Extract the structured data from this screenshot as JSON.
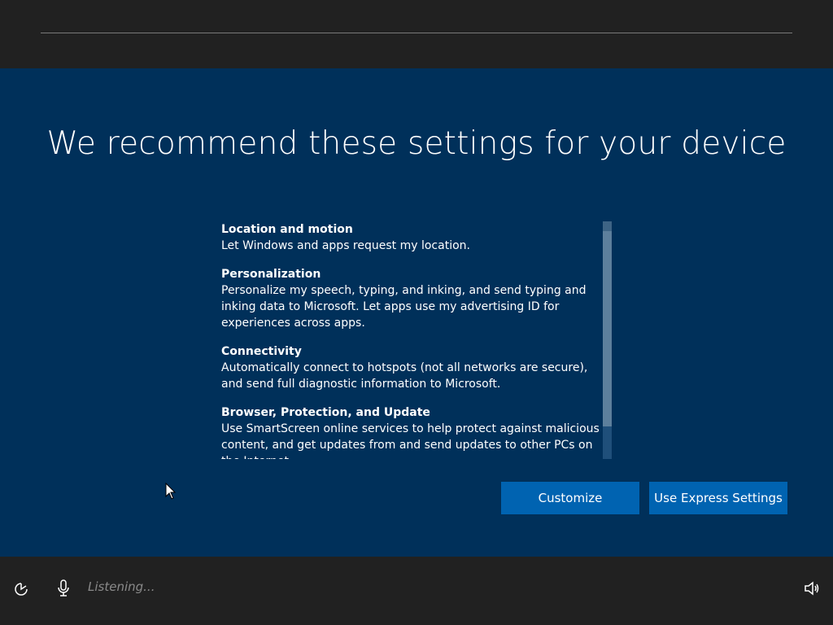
{
  "header": {},
  "main": {
    "title": "We recommend these settings for your device",
    "sections": [
      {
        "title": "Location and motion",
        "text": "Let Windows and apps request my location."
      },
      {
        "title": "Personalization",
        "text": "Personalize my speech, typing, and inking, and send typing and inking data to Microsoft. Let apps use my advertising ID for experiences across apps."
      },
      {
        "title": "Connectivity",
        "text": "Automatically connect to hotspots (not all networks are secure), and send full diagnostic information to Microsoft."
      },
      {
        "title": "Browser, Protection, and Update",
        "text": "Use SmartScreen online services to help protect against malicious content, and get updates from and send updates to other PCs on the Internet."
      }
    ],
    "buttons": {
      "customize": "Customize",
      "express": "Use Express Settings"
    }
  },
  "footer": {
    "listening": "Listening...",
    "icons": [
      "ease-of-access-icon",
      "microphone-icon",
      "volume-icon"
    ]
  },
  "colors": {
    "background": "#00305a",
    "bars": "#212121",
    "button": "#0063b1",
    "listening_text": "#8a8a8a"
  }
}
